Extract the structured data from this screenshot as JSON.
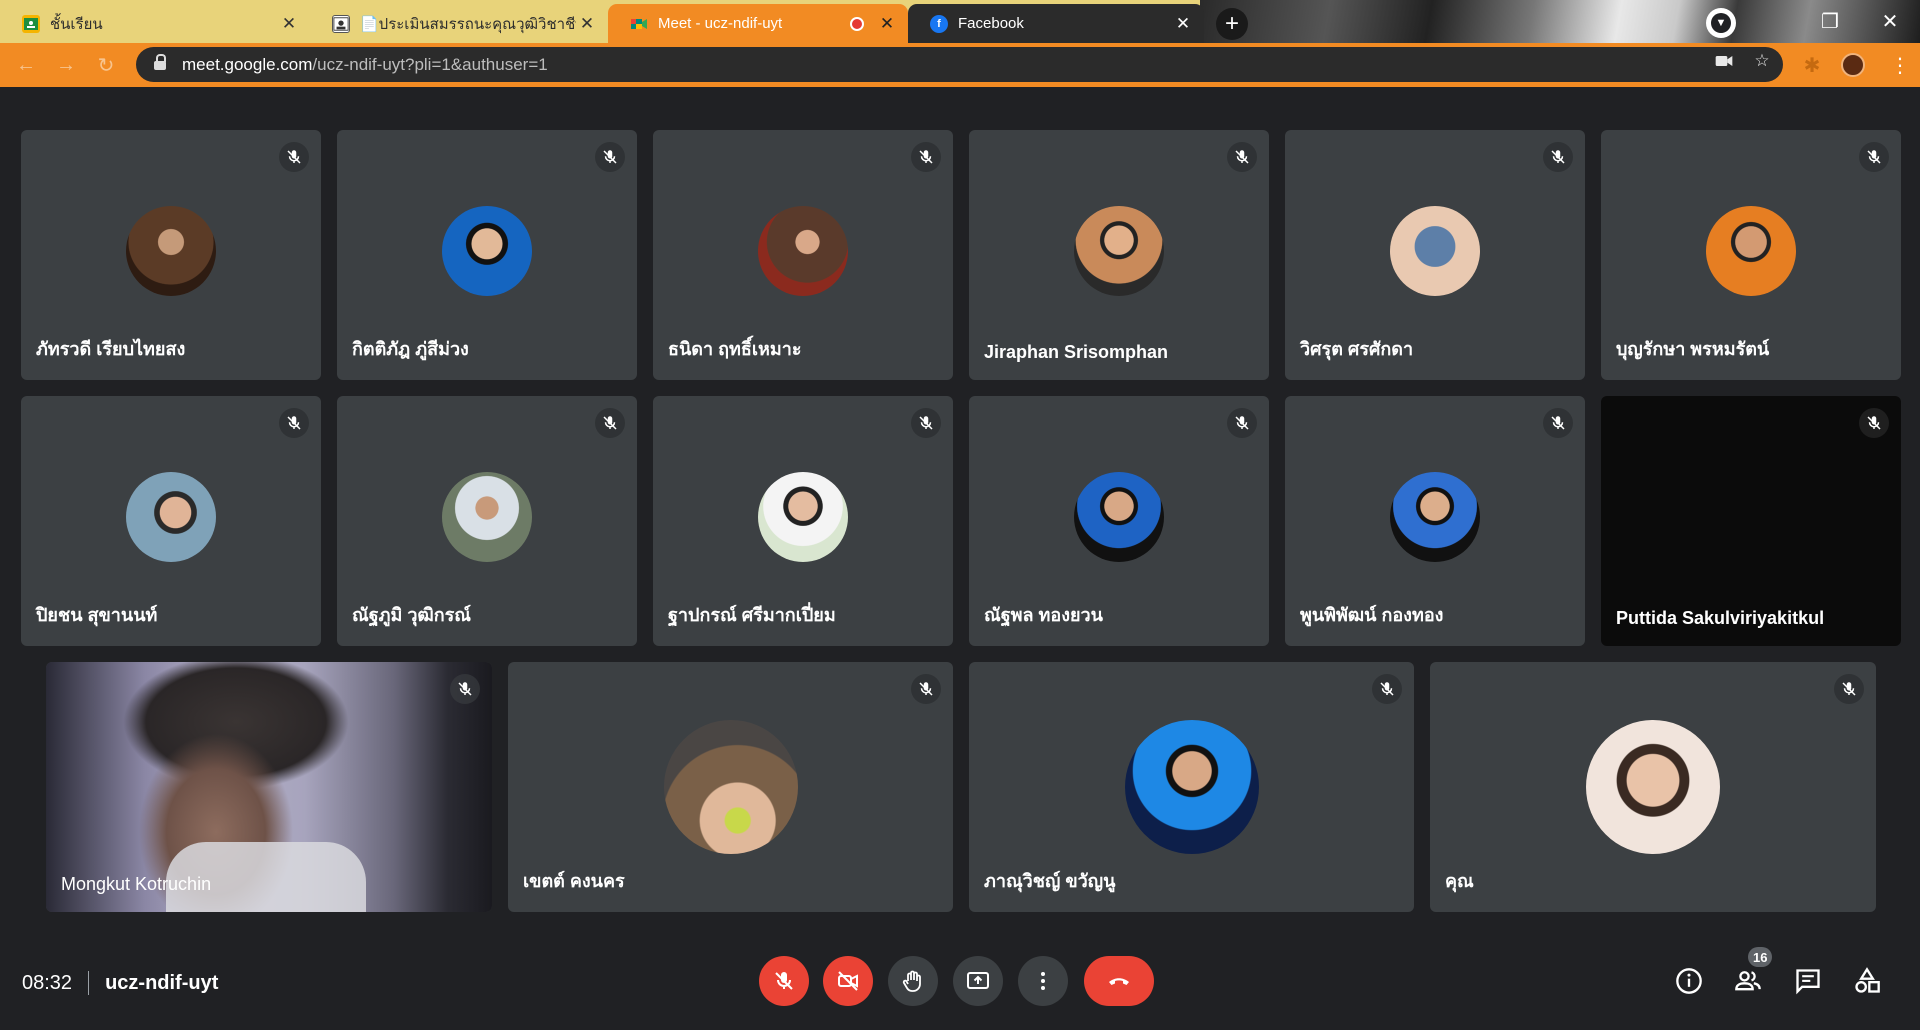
{
  "browser": {
    "tabs": [
      {
        "label": "ชั้นเรียน",
        "icon": "google-classroom-icon",
        "color": "#1e8e3e"
      },
      {
        "label": "📄ประเมินสมรรถนะคุณวุฒิวิชาชีพ",
        "icon": "contact-card-icon",
        "color": "#5f6368"
      },
      {
        "label": "Meet - ucz-ndif-uyt",
        "icon": "google-meet-icon",
        "color": "#00897b",
        "active": true,
        "recording": true
      },
      {
        "label": "Facebook",
        "icon": "facebook-icon",
        "color": "#1877f2"
      }
    ],
    "url_host": "meet.google.com",
    "url_path": "/ucz-ndif-uyt?pli=1&authuser=1",
    "theme_color": "#f28b23"
  },
  "participants": [
    {
      "name": "ภัทรวดี เรียบไทยสง",
      "avatar_color": "#5b3b26"
    },
    {
      "name": "กิตติภัฎ ภู่สีม่วง",
      "avatar_color": "#1565c0"
    },
    {
      "name": "ธนิดา ฤทธิ์เหมาะ",
      "avatar_color": "#5a3a2b"
    },
    {
      "name": "Jiraphan Srisomphan",
      "avatar_color": "#c98a5a"
    },
    {
      "name": "วิศรุต ศรศักดา",
      "avatar_color": "#e9c9b1"
    },
    {
      "name": "บุญรักษา พรหมรัตน์",
      "avatar_color": "#e67e22"
    },
    {
      "name": "ปิยชน สุขานนท์",
      "avatar_color": "#7fa2b8"
    },
    {
      "name": "ณัฐภูมิ วุฒิกรณ์",
      "avatar_color": "#6d7b66"
    },
    {
      "name": "ฐาปกรณ์ ศรีมากเปี่ยม",
      "avatar_color": "#d9e6d0"
    },
    {
      "name": "ณัฐพล ทองยวน",
      "avatar_color": "#1e63c4"
    },
    {
      "name": "พูนพิพัฒน์ กองทอง",
      "avatar_color": "#2f6fd0"
    },
    {
      "name": "Puttida Sakulviriyakitkul",
      "avatar_color": "#0b0b0b"
    },
    {
      "name": "Mongkut Kotruchin",
      "avatar_color": "#8a86a4"
    },
    {
      "name": "เขตต์ คงนคร",
      "avatar_color": "#7a6048"
    },
    {
      "name": "ภาณุวิชญ์ ขวัญนู",
      "avatar_color": "#1e88e5"
    },
    {
      "name": "คุณ",
      "avatar_color": "#f1e4dc"
    }
  ],
  "meeting": {
    "time": "08:32",
    "code": "ucz-ndif-uyt",
    "participant_count": "16",
    "mic_muted": true,
    "camera_off": true,
    "colors": {
      "danger": "#ea4335",
      "tile": "#3c4043",
      "background": "#202124"
    }
  }
}
